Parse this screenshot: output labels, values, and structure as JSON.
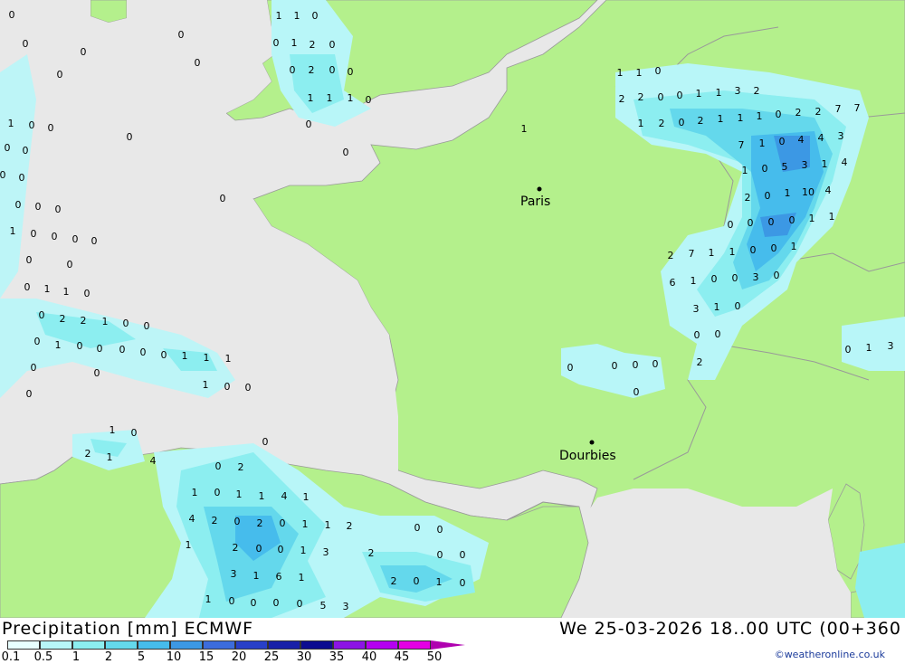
{
  "title": "Precipitation [mm] ECMWF",
  "datetime": "We 25-03-2026 18..00 UTC (00+360",
  "credit": "©weatheronline.co.uk",
  "colors": {
    "sea": "#e8e8e8",
    "land": "#b4f08c",
    "border": "#999999"
  },
  "legend": {
    "labels": [
      "0.1",
      "0.5",
      "1",
      "2",
      "5",
      "10",
      "15",
      "20",
      "25",
      "30",
      "35",
      "40",
      "45",
      "50"
    ],
    "colors": [
      "#e8ffff",
      "#b8f6f8",
      "#8ceef0",
      "#64d8ec",
      "#46bcec",
      "#3c98e4",
      "#3c6cdc",
      "#2840c8",
      "#1820a8",
      "#0c0c90",
      "#8c14e4",
      "#b400f0",
      "#e400e4",
      "#c800c0",
      "#a000a0"
    ]
  },
  "cities": [
    {
      "name": "Paris"
    },
    {
      "name": "Dourbies"
    }
  ],
  "values": [
    "0",
    "0",
    "1",
    "1",
    "0",
    "0",
    "0",
    "1",
    "2",
    "0",
    "0",
    "0",
    "2",
    "0",
    "0",
    "0",
    "1",
    "1",
    "1",
    "0",
    "0",
    "0",
    "0",
    "0",
    "0",
    "1",
    "0",
    "0",
    "0",
    "0",
    "0",
    "0",
    "0",
    "0",
    "0",
    "1",
    "0",
    "0",
    "0",
    "0",
    "0",
    "0",
    "0",
    "1",
    "1",
    "0",
    "0",
    "2",
    "2",
    "1",
    "0",
    "0",
    "0",
    "1",
    "0",
    "0",
    "0",
    "0",
    "0",
    "1",
    "1",
    "1",
    "0",
    "0",
    "1",
    "0",
    "0",
    "0",
    "1",
    "0",
    "2",
    "1",
    "4",
    "0",
    "0",
    "2",
    "1",
    "0",
    "1",
    "1",
    "4",
    "1",
    "4",
    "2",
    "0",
    "2",
    "0",
    "1",
    "1",
    "2",
    "1",
    "2",
    "0",
    "0",
    "1",
    "3",
    "3",
    "1",
    "6",
    "1",
    "1",
    "0",
    "0",
    "0",
    "0",
    "5",
    "3",
    "2",
    "2",
    "0",
    "1",
    "0",
    "0",
    "0",
    "0",
    "0",
    "1",
    "1",
    "1",
    "0",
    "2",
    "2",
    "0",
    "0",
    "1",
    "1",
    "3",
    "2",
    "1",
    "2",
    "0",
    "2",
    "1",
    "1",
    "1",
    "0",
    "2",
    "2",
    "7",
    "7",
    "7",
    "1",
    "0",
    "4",
    "4",
    "3",
    "1",
    "0",
    "5",
    "3",
    "1",
    "4",
    "2",
    "0",
    "1",
    "10",
    "4",
    "0",
    "0",
    "0",
    "0",
    "1",
    "1",
    "2",
    "7",
    "1",
    "1",
    "0",
    "0",
    "1",
    "6",
    "1",
    "0",
    "0",
    "3",
    "0",
    "3",
    "1",
    "0",
    "0",
    "0",
    "0",
    "0",
    "0",
    "0",
    "2",
    "0",
    "0",
    "1",
    "3"
  ]
}
